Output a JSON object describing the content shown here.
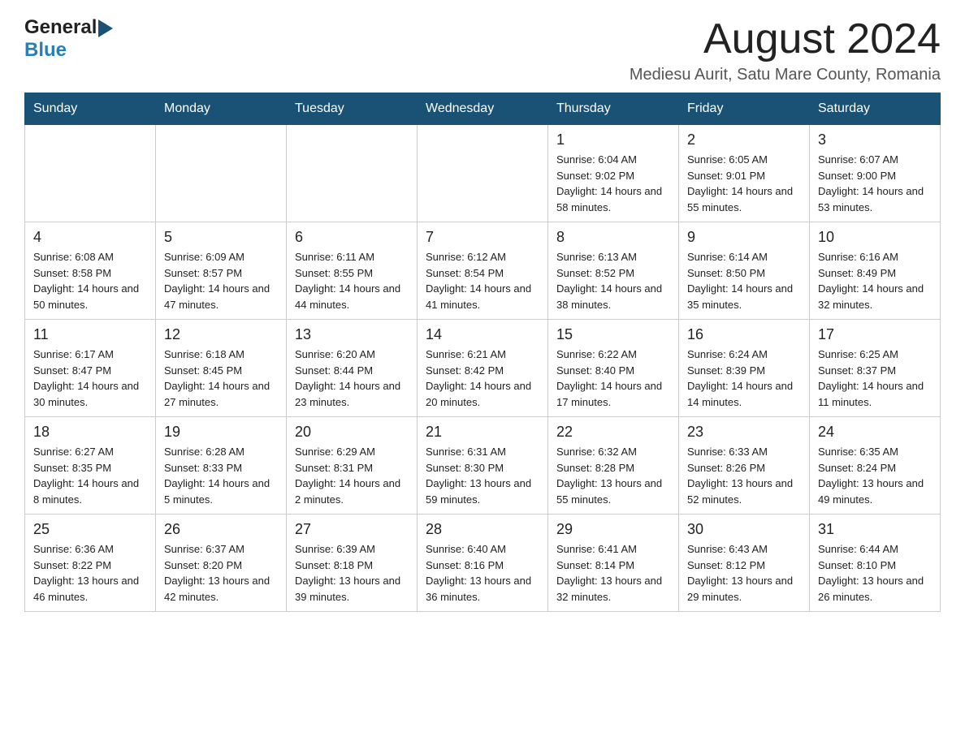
{
  "header": {
    "logo_general": "General",
    "logo_blue": "Blue",
    "main_title": "August 2024",
    "subtitle": "Mediesu Aurit, Satu Mare County, Romania"
  },
  "days_of_week": [
    "Sunday",
    "Monday",
    "Tuesday",
    "Wednesday",
    "Thursday",
    "Friday",
    "Saturday"
  ],
  "weeks": [
    {
      "days": [
        {
          "number": "",
          "info": ""
        },
        {
          "number": "",
          "info": ""
        },
        {
          "number": "",
          "info": ""
        },
        {
          "number": "",
          "info": ""
        },
        {
          "number": "1",
          "info": "Sunrise: 6:04 AM\nSunset: 9:02 PM\nDaylight: 14 hours and 58 minutes."
        },
        {
          "number": "2",
          "info": "Sunrise: 6:05 AM\nSunset: 9:01 PM\nDaylight: 14 hours and 55 minutes."
        },
        {
          "number": "3",
          "info": "Sunrise: 6:07 AM\nSunset: 9:00 PM\nDaylight: 14 hours and 53 minutes."
        }
      ]
    },
    {
      "days": [
        {
          "number": "4",
          "info": "Sunrise: 6:08 AM\nSunset: 8:58 PM\nDaylight: 14 hours and 50 minutes."
        },
        {
          "number": "5",
          "info": "Sunrise: 6:09 AM\nSunset: 8:57 PM\nDaylight: 14 hours and 47 minutes."
        },
        {
          "number": "6",
          "info": "Sunrise: 6:11 AM\nSunset: 8:55 PM\nDaylight: 14 hours and 44 minutes."
        },
        {
          "number": "7",
          "info": "Sunrise: 6:12 AM\nSunset: 8:54 PM\nDaylight: 14 hours and 41 minutes."
        },
        {
          "number": "8",
          "info": "Sunrise: 6:13 AM\nSunset: 8:52 PM\nDaylight: 14 hours and 38 minutes."
        },
        {
          "number": "9",
          "info": "Sunrise: 6:14 AM\nSunset: 8:50 PM\nDaylight: 14 hours and 35 minutes."
        },
        {
          "number": "10",
          "info": "Sunrise: 6:16 AM\nSunset: 8:49 PM\nDaylight: 14 hours and 32 minutes."
        }
      ]
    },
    {
      "days": [
        {
          "number": "11",
          "info": "Sunrise: 6:17 AM\nSunset: 8:47 PM\nDaylight: 14 hours and 30 minutes."
        },
        {
          "number": "12",
          "info": "Sunrise: 6:18 AM\nSunset: 8:45 PM\nDaylight: 14 hours and 27 minutes."
        },
        {
          "number": "13",
          "info": "Sunrise: 6:20 AM\nSunset: 8:44 PM\nDaylight: 14 hours and 23 minutes."
        },
        {
          "number": "14",
          "info": "Sunrise: 6:21 AM\nSunset: 8:42 PM\nDaylight: 14 hours and 20 minutes."
        },
        {
          "number": "15",
          "info": "Sunrise: 6:22 AM\nSunset: 8:40 PM\nDaylight: 14 hours and 17 minutes."
        },
        {
          "number": "16",
          "info": "Sunrise: 6:24 AM\nSunset: 8:39 PM\nDaylight: 14 hours and 14 minutes."
        },
        {
          "number": "17",
          "info": "Sunrise: 6:25 AM\nSunset: 8:37 PM\nDaylight: 14 hours and 11 minutes."
        }
      ]
    },
    {
      "days": [
        {
          "number": "18",
          "info": "Sunrise: 6:27 AM\nSunset: 8:35 PM\nDaylight: 14 hours and 8 minutes."
        },
        {
          "number": "19",
          "info": "Sunrise: 6:28 AM\nSunset: 8:33 PM\nDaylight: 14 hours and 5 minutes."
        },
        {
          "number": "20",
          "info": "Sunrise: 6:29 AM\nSunset: 8:31 PM\nDaylight: 14 hours and 2 minutes."
        },
        {
          "number": "21",
          "info": "Sunrise: 6:31 AM\nSunset: 8:30 PM\nDaylight: 13 hours and 59 minutes."
        },
        {
          "number": "22",
          "info": "Sunrise: 6:32 AM\nSunset: 8:28 PM\nDaylight: 13 hours and 55 minutes."
        },
        {
          "number": "23",
          "info": "Sunrise: 6:33 AM\nSunset: 8:26 PM\nDaylight: 13 hours and 52 minutes."
        },
        {
          "number": "24",
          "info": "Sunrise: 6:35 AM\nSunset: 8:24 PM\nDaylight: 13 hours and 49 minutes."
        }
      ]
    },
    {
      "days": [
        {
          "number": "25",
          "info": "Sunrise: 6:36 AM\nSunset: 8:22 PM\nDaylight: 13 hours and 46 minutes."
        },
        {
          "number": "26",
          "info": "Sunrise: 6:37 AM\nSunset: 8:20 PM\nDaylight: 13 hours and 42 minutes."
        },
        {
          "number": "27",
          "info": "Sunrise: 6:39 AM\nSunset: 8:18 PM\nDaylight: 13 hours and 39 minutes."
        },
        {
          "number": "28",
          "info": "Sunrise: 6:40 AM\nSunset: 8:16 PM\nDaylight: 13 hours and 36 minutes."
        },
        {
          "number": "29",
          "info": "Sunrise: 6:41 AM\nSunset: 8:14 PM\nDaylight: 13 hours and 32 minutes."
        },
        {
          "number": "30",
          "info": "Sunrise: 6:43 AM\nSunset: 8:12 PM\nDaylight: 13 hours and 29 minutes."
        },
        {
          "number": "31",
          "info": "Sunrise: 6:44 AM\nSunset: 8:10 PM\nDaylight: 13 hours and 26 minutes."
        }
      ]
    }
  ]
}
